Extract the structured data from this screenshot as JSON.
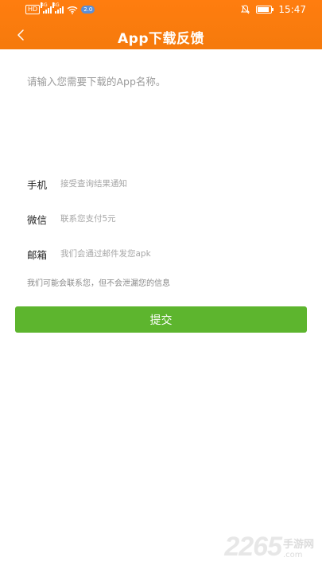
{
  "status_bar": {
    "hd_label": "HD",
    "sim1_label": "4G",
    "sim2_label": "4G",
    "badge": "2.0",
    "time": "15:47",
    "battery_level": 0.9
  },
  "header": {
    "title": "App下载反馈",
    "back_icon": "chevron-left-icon"
  },
  "form": {
    "app_name_placeholder": "请输入您需要下载的App名称。",
    "fields": [
      {
        "label": "手机",
        "placeholder": "接受查询结果通知"
      },
      {
        "label": "微信",
        "placeholder": "联系您支付5元"
      },
      {
        "label": "邮箱",
        "placeholder": "我们会通过邮件发您apk"
      }
    ],
    "privacy_note": "我们可能会联系您，但不会泄漏您的信息",
    "submit_label": "提交"
  },
  "watermark": {
    "number": "2265",
    "text": "手游网",
    "domain": ".com"
  },
  "colors": {
    "header": "#f57a0c",
    "submit": "#5db52e"
  }
}
